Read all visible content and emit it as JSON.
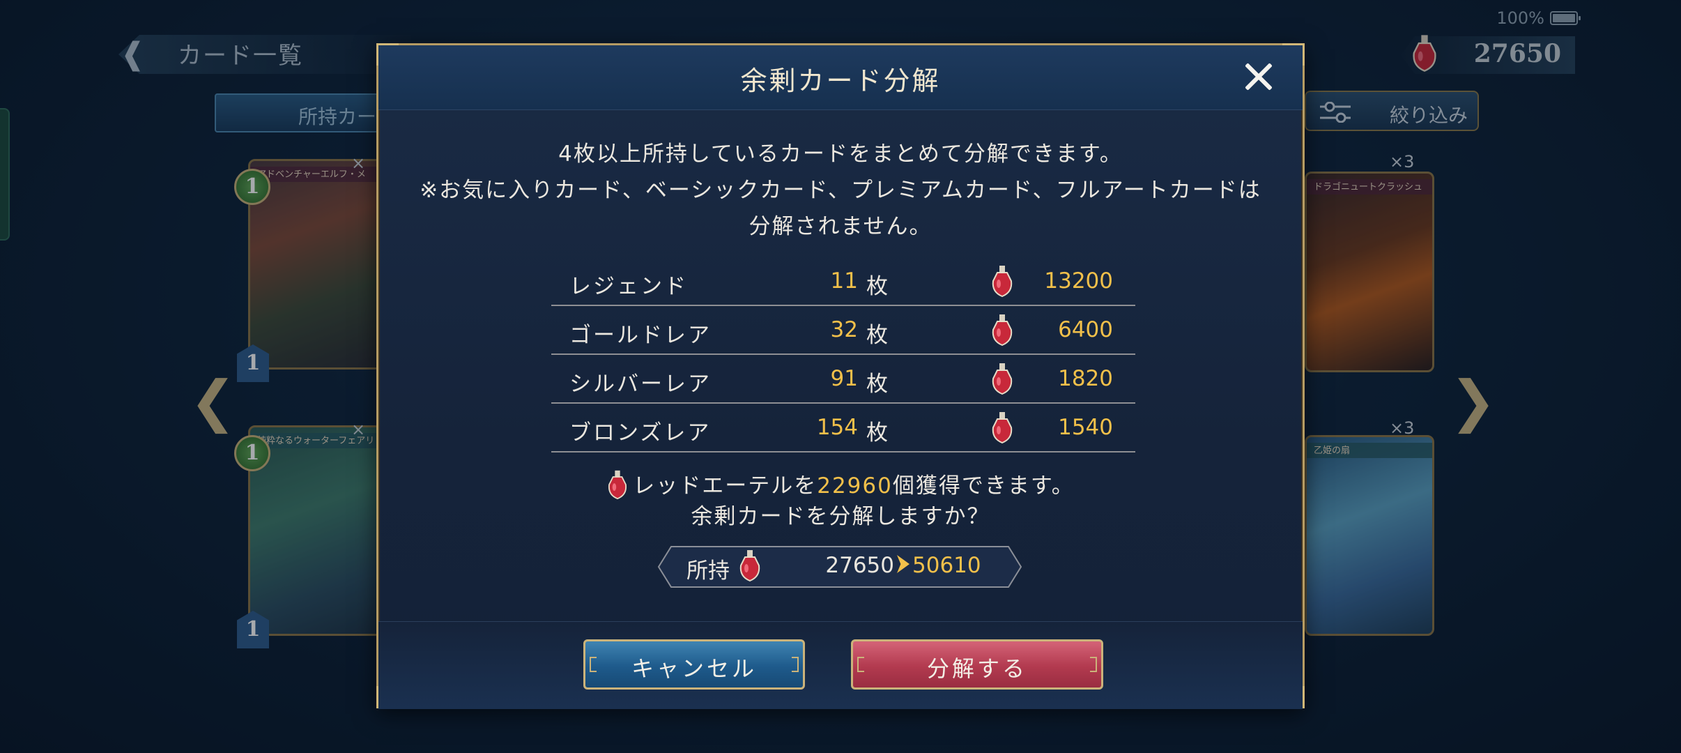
{
  "status_bar": {
    "battery": "100%"
  },
  "header": {
    "back_title": "カード一覧",
    "currency_amount": "27650"
  },
  "tabs": {
    "owned_label": "所持カー"
  },
  "filter": {
    "label": "絞り込み"
  },
  "cards": {
    "left_top": {
      "name": "アドベンチャーエルフ・メ",
      "cost": "1",
      "attack": "1"
    },
    "left_bottom": {
      "name": "純粋なるウォーターフェアリ",
      "cost": "1",
      "attack": "1"
    },
    "right_top": {
      "name": "ドラゴニュートクラッシュ",
      "count": "×3"
    },
    "right_bottom": {
      "name": "乙姫の扇",
      "count": "×3"
    },
    "left_top_count": "×",
    "left_bottom_count": "×"
  },
  "modal": {
    "title": "余剰カード分解",
    "description_line1": "4枚以上所持しているカードをまとめて分解できます。",
    "description_line2": "※お気に入りカード、ベーシックカード、プレミアムカード、フルアートカードは",
    "description_line3": "分解されません。",
    "rows": [
      {
        "rarity": "レジェンド",
        "count": "11",
        "unit": "枚",
        "value": "13200"
      },
      {
        "rarity": "ゴールドレア",
        "count": "32",
        "unit": "枚",
        "value": "6400"
      },
      {
        "rarity": "シルバーレア",
        "count": "91",
        "unit": "枚",
        "value": "1820"
      },
      {
        "rarity": "ブロンズレア",
        "count": "154",
        "unit": "枚",
        "value": "1540"
      }
    ],
    "gain_prefix": "レッドエーテルを",
    "gain_amount": "22960",
    "gain_suffix": "個獲得できます。",
    "confirm_question": "余剰カードを分解しますか？",
    "own_label": "所持",
    "own_before": "27650",
    "own_after": "50610",
    "cancel_label": "キャンセル",
    "confirm_label": "分解する"
  },
  "icons": {
    "currency": "red-ether-icon",
    "close": "close-icon",
    "back": "back-arrow-icon",
    "filter": "filter-sliders-icon"
  },
  "colors": {
    "accent_gold": "#f2c04a",
    "frame_gold": "#b69c63",
    "cancel_blue": "#1e5a8b",
    "confirm_red": "#b23a4f"
  }
}
